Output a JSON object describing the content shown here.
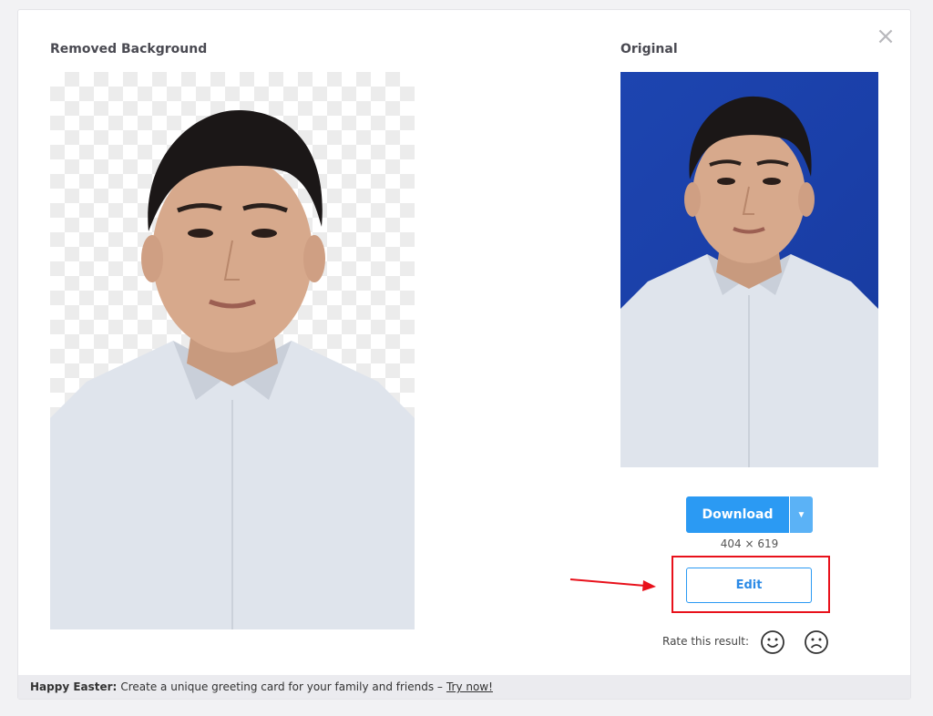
{
  "dialog": {
    "left_heading": "Removed Background",
    "right_heading": "Original",
    "close_icon": "×"
  },
  "actions": {
    "download_label": "Download",
    "caret": "▼",
    "dimensions": "404 × 619",
    "edit_label": "Edit"
  },
  "rating": {
    "label": "Rate this result:",
    "icons": [
      "smiley-happy-icon",
      "smiley-sad-icon"
    ]
  },
  "footer": {
    "bold_text": "Happy Easter:",
    "text": "Create a unique greeting card for your family and friends –",
    "link": "Try now!"
  },
  "colors": {
    "accent": "#2b9af3",
    "highlight": "#e8111b",
    "original_background": "#1a3fa8"
  }
}
